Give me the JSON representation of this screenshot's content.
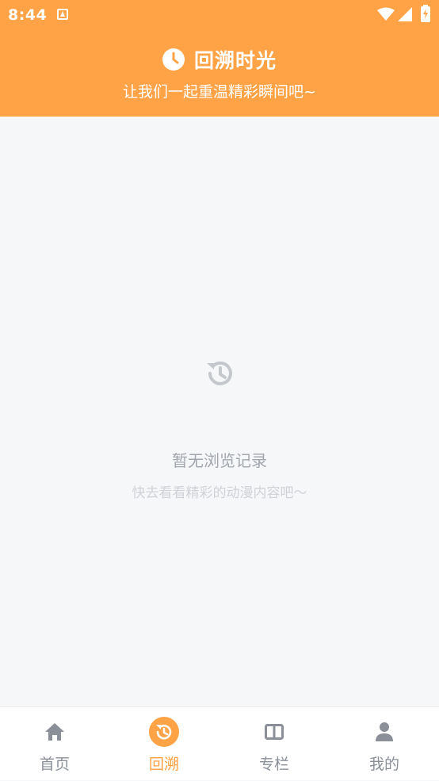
{
  "status_bar": {
    "time": "8:44",
    "icons": [
      "notification-icon",
      "wifi-icon",
      "signal-icon",
      "battery-icon"
    ]
  },
  "header": {
    "title": "回溯时光",
    "subtitle": "让我们一起重温精彩瞬间吧~",
    "icon": "clock-icon",
    "background_color": "#ffa346"
  },
  "empty_state": {
    "icon": "history-icon",
    "title": "暂无浏览记录",
    "subtitle": "快去看看精彩的动漫内容吧～"
  },
  "tabbar": {
    "active_color": "#ff9f3f",
    "tabs": [
      {
        "label": "首页",
        "icon": "home-icon",
        "active": false
      },
      {
        "label": "回溯",
        "icon": "history-icon",
        "active": true
      },
      {
        "label": "专栏",
        "icon": "columns-icon",
        "active": false
      },
      {
        "label": "我的",
        "icon": "user-icon",
        "active": false
      }
    ]
  }
}
